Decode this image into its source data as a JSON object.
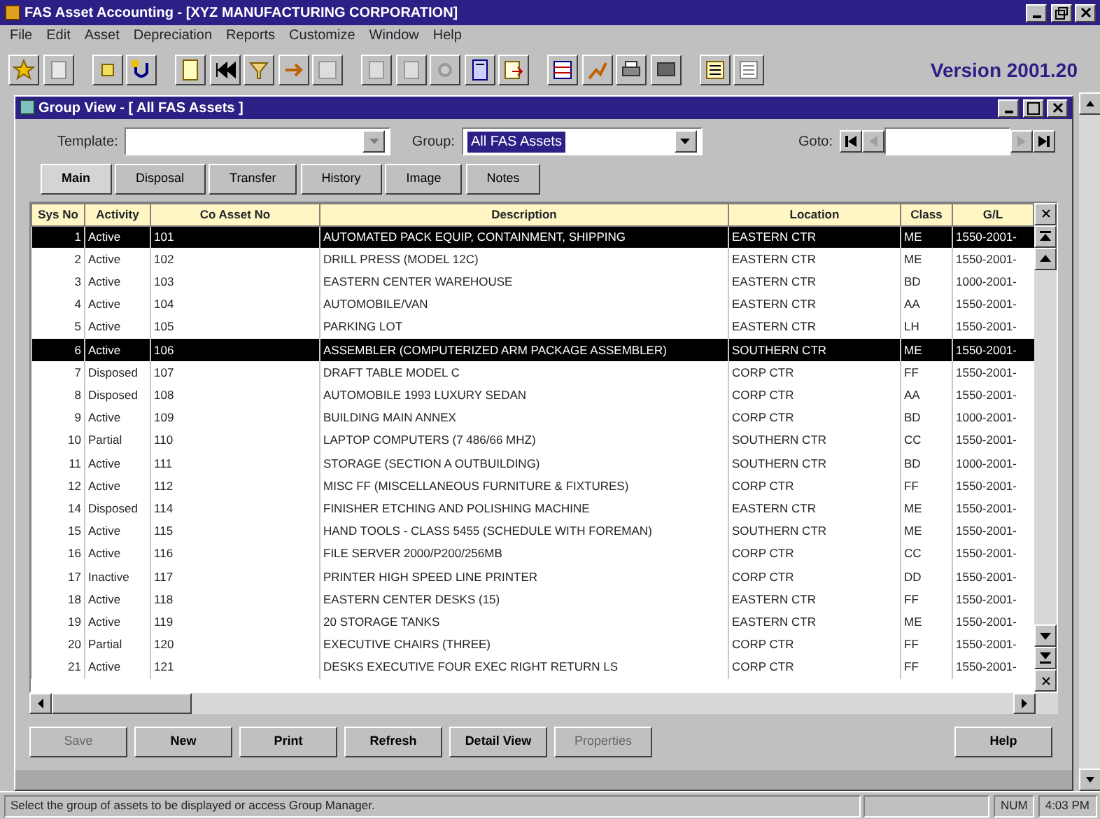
{
  "window": {
    "title": "FAS Asset Accounting - [XYZ MANUFACTURING CORPORATION]"
  },
  "menu": [
    "File",
    "Edit",
    "Asset",
    "Depreciation",
    "Reports",
    "Customize",
    "Window",
    "Help"
  ],
  "version": "Version 2001.20",
  "group_view": {
    "title": "Group View - [ All FAS Assets ]",
    "template": {
      "label": "Template:"
    },
    "group": {
      "label": "Group:",
      "value": "All FAS Assets"
    },
    "goto": {
      "label": "Goto:"
    },
    "tabs": [
      {
        "label": "Main",
        "selected": true
      },
      {
        "label": "Disposal",
        "selected": false
      },
      {
        "label": "Transfer",
        "selected": false
      },
      {
        "label": "History",
        "selected": false
      },
      {
        "label": "Image",
        "selected": false
      },
      {
        "label": "Notes",
        "selected": false
      }
    ],
    "table": {
      "columns": [
        "Sys No",
        "Activity",
        "Co Asset No",
        "Description",
        "Location",
        "Class",
        "G/L"
      ],
      "rows": [
        {
          "cells": [
            "1",
            "Active",
            "101",
            "AUTOMATED PACK EQUIP, CONTAINMENT, SHIPPING",
            "EASTERN CTR",
            "ME",
            "1550-2001-"
          ],
          "selected": true
        },
        {
          "cells": [
            "2",
            "Active",
            "102",
            "DRILL PRESS (MODEL 12C)",
            "EASTERN CTR",
            "ME",
            "1550-2001-"
          ],
          "selected": false
        },
        {
          "cells": [
            "3",
            "Active",
            "103",
            "EASTERN CENTER WAREHOUSE",
            "EASTERN CTR",
            "BD",
            "1000-2001-"
          ],
          "selected": false
        },
        {
          "cells": [
            "4",
            "Active",
            "104",
            "AUTOMOBILE/VAN",
            "EASTERN CTR",
            "AA",
            "1550-2001-"
          ],
          "selected": false
        },
        {
          "cells": [
            "5",
            "Active",
            "105",
            "PARKING LOT",
            "EASTERN CTR",
            "LH",
            "1550-2001-"
          ],
          "selected": false
        },
        {
          "cells": [
            "6",
            "Active",
            "106",
            "ASSEMBLER (COMPUTERIZED ARM PACKAGE ASSEMBLER)",
            "SOUTHERN CTR",
            "ME",
            "1550-2001-"
          ],
          "selected": true
        },
        {
          "cells": [
            "7",
            "Disposed",
            "107",
            "DRAFT TABLE MODEL C",
            "CORP CTR",
            "FF",
            "1550-2001-"
          ],
          "selected": false
        },
        {
          "cells": [
            "8",
            "Disposed",
            "108",
            "AUTOMOBILE 1993 LUXURY SEDAN",
            "CORP CTR",
            "AA",
            "1550-2001-"
          ],
          "selected": false
        },
        {
          "cells": [
            "9",
            "Active",
            "109",
            "BUILDING MAIN ANNEX",
            "CORP CTR",
            "BD",
            "1000-2001-"
          ],
          "selected": false
        },
        {
          "cells": [
            "10",
            "Partial",
            "110",
            "LAPTOP COMPUTERS (7 486/66 MHZ)",
            "SOUTHERN CTR",
            "CC",
            "1550-2001-"
          ],
          "selected": false
        },
        {
          "cells": [
            "11",
            "Active",
            "111",
            "STORAGE (SECTION A OUTBUILDING)",
            "SOUTHERN CTR",
            "BD",
            "1000-2001-"
          ],
          "selected": false
        },
        {
          "cells": [
            "12",
            "Active",
            "112",
            "MISC FF (MISCELLANEOUS FURNITURE & FIXTURES)",
            "CORP CTR",
            "FF",
            "1550-2001-"
          ],
          "selected": false
        },
        {
          "cells": [
            "14",
            "Disposed",
            "114",
            "FINISHER ETCHING AND POLISHING MACHINE",
            "EASTERN CTR",
            "ME",
            "1550-2001-"
          ],
          "selected": false
        },
        {
          "cells": [
            "15",
            "Active",
            "115",
            "HAND TOOLS - CLASS 5455 (SCHEDULE WITH FOREMAN)",
            "SOUTHERN CTR",
            "ME",
            "1550-2001-"
          ],
          "selected": false
        },
        {
          "cells": [
            "16",
            "Active",
            "116",
            "FILE SERVER 2000/P200/256MB",
            "CORP CTR",
            "CC",
            "1550-2001-"
          ],
          "selected": false
        },
        {
          "cells": [
            "17",
            "Inactive",
            "117",
            "PRINTER HIGH SPEED LINE PRINTER",
            "CORP CTR",
            "DD",
            "1550-2001-"
          ],
          "selected": false
        },
        {
          "cells": [
            "18",
            "Active",
            "118",
            "EASTERN CENTER DESKS (15)",
            "EASTERN CTR",
            "FF",
            "1550-2001-"
          ],
          "selected": false
        },
        {
          "cells": [
            "19",
            "Active",
            "119",
            "20 STORAGE TANKS",
            "EASTERN CTR",
            "ME",
            "1550-2001-"
          ],
          "selected": false
        },
        {
          "cells": [
            "20",
            "Partial",
            "120",
            "EXECUTIVE CHAIRS (THREE)",
            "CORP CTR",
            "FF",
            "1550-2001-"
          ],
          "selected": false
        },
        {
          "cells": [
            "21",
            "Active",
            "121",
            "DESKS EXECUTIVE  FOUR EXEC RIGHT RETURN LS",
            "CORP CTR",
            "FF",
            "1550-2001-"
          ],
          "selected": false
        }
      ]
    },
    "buttons": [
      {
        "label": "Save",
        "disabled": true
      },
      {
        "label": "New",
        "disabled": false
      },
      {
        "label": "Print",
        "disabled": false
      },
      {
        "label": "Refresh",
        "disabled": false
      },
      {
        "label": "Detail View",
        "disabled": false
      },
      {
        "label": "Properties",
        "disabled": true
      },
      {
        "label": "Help",
        "disabled": false
      }
    ]
  },
  "status_bar": {
    "message": "Select the group of assets to be displayed or access Group Manager.",
    "indicator": "NUM",
    "time": "4:03 PM"
  }
}
